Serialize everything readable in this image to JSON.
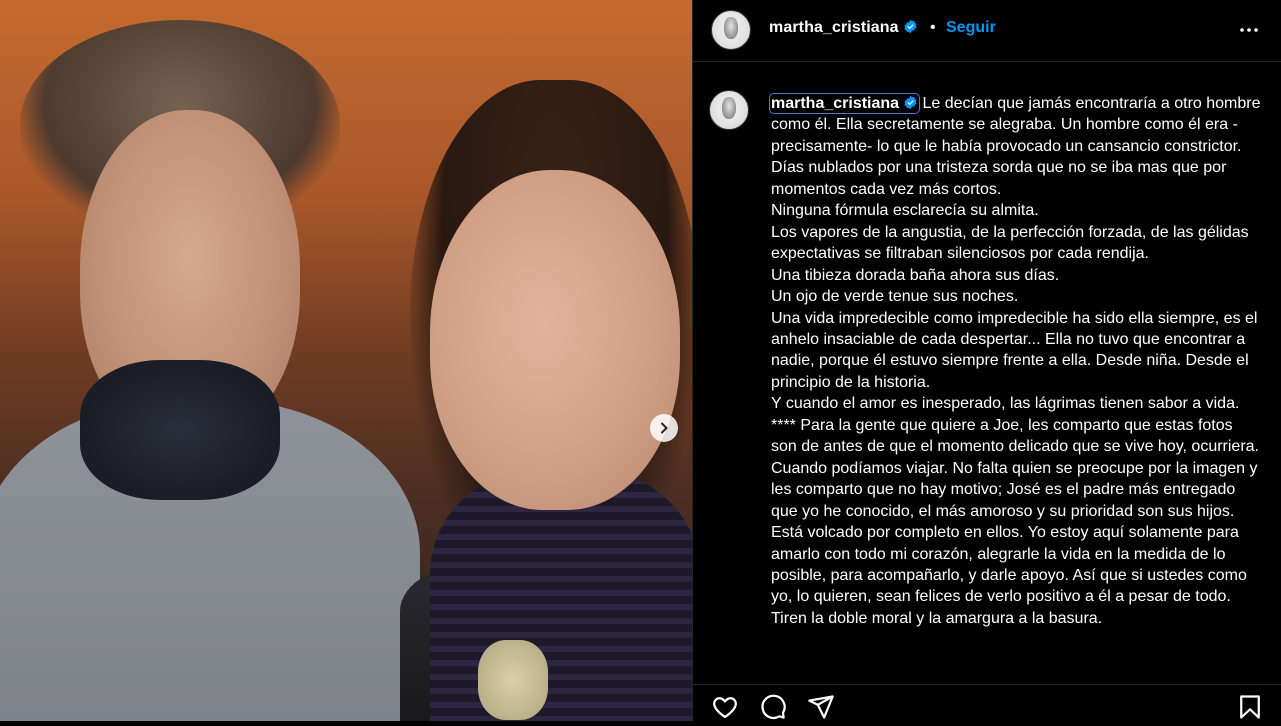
{
  "post": {
    "username": "martha_cristiana",
    "separator": "•",
    "follow_label": "Seguir",
    "caption_lines": [
      "Le decían que jamás encontraría a otro hombre como él. Ella secretamente se alegraba. Un hombre como él era -precisamente- lo que le había provocado un cansancio constrictor. Días nublados por una tristeza sorda que no se iba mas que por momentos cada vez más cortos.",
      "Ninguna fórmula esclarecía su almita.",
      "Los vapores de la angustia, de la perfección forzada, de las gélidas expectativas se filtraban silenciosos por cada rendija.",
      "Una tibieza dorada baña ahora sus días.",
      "Un ojo de verde tenue sus noches.",
      "Una vida impredecible como impredecible ha sido ella siempre, es el anhelo insaciable de cada despertar... Ella no tuvo que encontrar a nadie, porque él estuvo siempre frente a ella. Desde niña. Desde el principio de la historia.",
      "Y cuando el amor es inesperado, las lágrimas tienen sabor a vida. **** Para la gente que quiere a Joe, les comparto que estas fotos son de antes de que el momento delicado que se vive hoy, ocurriera.",
      "Cuando podíamos viajar. No falta quien se preocupe por la imagen y les comparto que no hay motivo; José es el padre más entregado que yo he conocido, el más amoroso y su prioridad son sus hijos. Está volcado por completo en ellos. Yo estoy aquí solamente para amarlo con todo mi corazón, alegrarle la vida en la medida de lo posible, para acompañarlo, y darle apoyo. Así que si ustedes como yo, lo quieren, sean felices de verlo positivo a él a pesar de todo. Tiren la doble moral y la amargura a la basura."
    ]
  },
  "colors": {
    "accent": "#0095f6",
    "verified": "#0095f6",
    "background": "#000000",
    "text": "#ffffff"
  },
  "icons": {
    "header": [
      "verified-badge-icon",
      "more-options-icon"
    ],
    "carousel": [
      "chevron-right-icon"
    ],
    "actions": [
      "heart-icon",
      "comment-icon",
      "share-icon",
      "bookmark-icon"
    ]
  }
}
